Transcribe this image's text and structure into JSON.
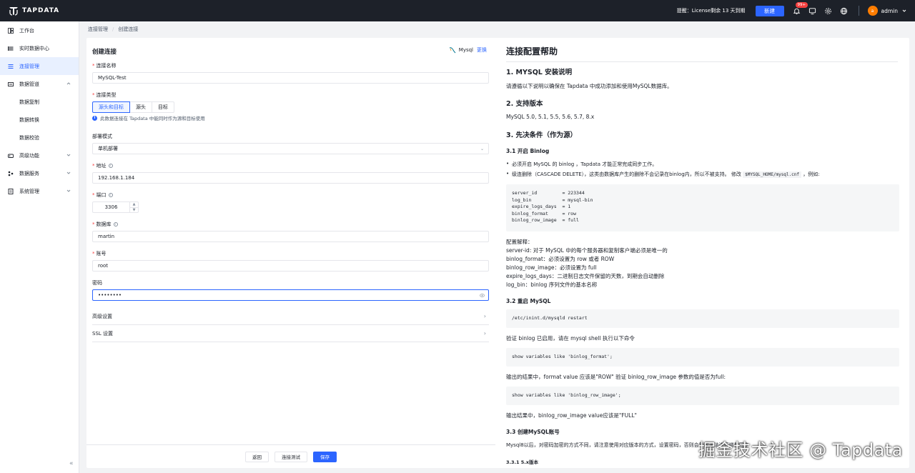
{
  "header": {
    "logo_text": "TAPDATA",
    "notice": "提醒：License剩余 13 天到期",
    "new_button": "新建",
    "badge": "99+",
    "avatar_initial": "a",
    "user": "admin"
  },
  "sidebar": {
    "items": [
      {
        "label": "工作台",
        "icon": "workbench-icon"
      },
      {
        "label": "实时数据中心",
        "icon": "data-center-icon"
      },
      {
        "label": "连接管理",
        "icon": "connection-icon",
        "active": true
      },
      {
        "label": "数据管道",
        "icon": "pipeline-icon"
      },
      {
        "label": "高级功能",
        "icon": "advanced-icon"
      },
      {
        "label": "数据服务",
        "icon": "service-icon"
      },
      {
        "label": "系统管理",
        "icon": "system-icon"
      }
    ],
    "sub_items": [
      "数据复制",
      "数据转换",
      "数据校验"
    ],
    "collapse": "«"
  },
  "breadcrumb": [
    "连接管理",
    "创建连接"
  ],
  "form": {
    "title": "创建连接",
    "db_type": "Mysql",
    "change": "更换",
    "name_label": "连接名称",
    "name_value": "MySQL-Test",
    "type_label": "连接类型",
    "type_options": [
      "源头和目标",
      "源头",
      "目标"
    ],
    "type_tip": "此数据连接在 Tapdata 中能同时作为源和目标使用",
    "deploy_label": "部署模式",
    "deploy_value": "单机部署",
    "address_label": "地址",
    "address_value": "192.168.1.184",
    "port_label": "端口",
    "port_value": "3306",
    "db_label": "数据库",
    "db_value": "martin",
    "account_label": "账号",
    "account_value": "root",
    "password_label": "密码",
    "password_value": "••••••••",
    "advanced": "高级设置",
    "ssl": "SSL 设置",
    "back": "返回",
    "test": "连接测试",
    "save": "保存"
  },
  "help": {
    "title": "连接配置帮助",
    "h1": "1. MYSQL 安装说明",
    "p1": "请遵循以下说明以确保在 Tapdata 中成功添加和使用MySQL数据库。",
    "h2": "2. 支持版本",
    "p2": "MySQL 5.0, 5.1, 5.5, 5.6, 5.7, 8.x",
    "h3": "3. 先决条件（作为源）",
    "h31": "3.1 开启 Binlog",
    "li1": "必须开启 MySQL 的 binlog ，Tapdata 才能正常完成同步工作。",
    "li2": "级连删除（CASCADE DELETE），这类由数据库产生的删除不会记录在binlog内，所以不被支持。 修改",
    "li2_code": "$MYSQL_HOME/mysql.cnf",
    "li2_end": "，例如:",
    "code1": "server_id         = 223344\nlog_bin           = mysql-bin\nexpire_logs_days  = 1\nbinlog_format     = row\nbinlog_row_image  = full",
    "cfg_title": "配置解释：",
    "cfg1": "server-id: 对于 MySQL 中的每个服务器和复制客户端必须是唯一的",
    "cfg2": "binlog_format：必须设置为 row 或者 ROW",
    "cfg3": "binlog_row_image：必须设置为 full",
    "cfg4": "expire_logs_days：二进制日志文件保留的天数，到期会自动删除",
    "cfg5": "log_bin：binlog 序列文件的基本名称",
    "h32": "3.2 重启 MySQL",
    "code2": "/etc/inint.d/mysqld restart",
    "p3": "验证 binlog 已启用，请在 mysql shell 执行以下命令",
    "code3": "show variables like 'binlog_format';",
    "p4": "输出的结果中，format value 应该是\"ROW\" 验证 binlog_row_image 参数的值是否为full:",
    "code4": "show variables like 'binlog_row_image';",
    "p5": "输出结果中，binlog_row_image value应该是\"FULL\"",
    "h33": "3.3 创建MySQL账号",
    "p6": "Mysql8以后，对密码加密的方式不同，请注意使用对应版本的方式，设置密码，否则会导致无法进行增量同步",
    "h331": "3.3.1 5.x版本"
  },
  "watermark": "掘金技术社区 @ Tapdata",
  "colors": {
    "primary": "#2c65ff",
    "header_bg": "#1d2129",
    "required": "#f53f3f"
  }
}
